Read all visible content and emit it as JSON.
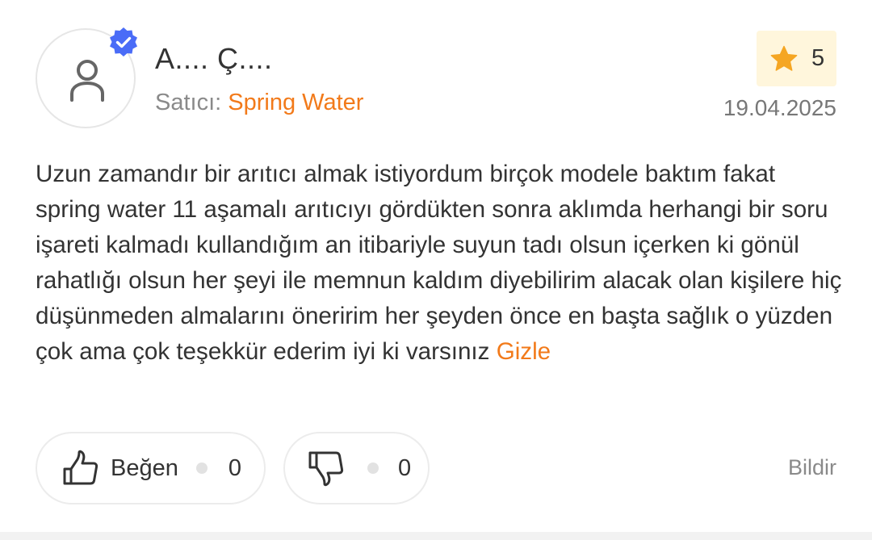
{
  "reviewer": {
    "name": "A.... Ç....",
    "avatar_icon": "user-icon",
    "verified_icon": "verified-badge-icon",
    "verified_color": "#4a6cf7"
  },
  "seller": {
    "label": "Satıcı:",
    "name": "Spring Water",
    "name_color": "#f27a1a"
  },
  "rating": {
    "icon": "star-icon",
    "star_color": "#f5a623",
    "value": "5"
  },
  "date": "19.04.2025",
  "review": {
    "text": "Uzun zamandır bir arıtıcı almak istiyordum birçok modele baktım fakat spring water 11 aşamalı arıtıcıyı gördükten sonra aklımda herhangi bir soru işareti kalmadı kullandığım an itibariyle suyun tadı olsun içerken ki gönül rahatlığı olsun her şeyi ile memnun kaldım diyebilirim alacak olan kişilere hiç düşünmeden almalarını öneririm her şeyden önce en başta sağlık o yüzden çok ama çok teşekkür ederim iyi ki varsınız",
    "hide_label": "Gizle"
  },
  "actions": {
    "like": {
      "icon": "thumbs-up-icon",
      "label": "Beğen",
      "count": "0"
    },
    "dislike": {
      "icon": "thumbs-down-icon",
      "count": "0"
    },
    "report_label": "Bildir"
  }
}
